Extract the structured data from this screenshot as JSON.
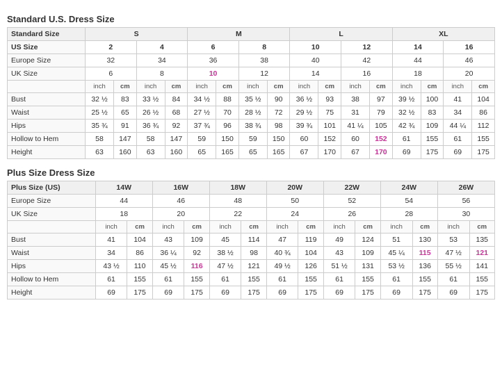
{
  "standard": {
    "title": "Standard U.S. Dress Size",
    "sizes": {
      "standard": [
        "S",
        "M",
        "L",
        "XL"
      ],
      "us": [
        "2",
        "4",
        "6",
        "8",
        "10",
        "12",
        "14",
        "16"
      ],
      "europe": [
        "32",
        "34",
        "36",
        "38",
        "40",
        "42",
        "44",
        "46"
      ],
      "uk": [
        "6",
        "8",
        "10",
        "12",
        "14",
        "16",
        "18",
        "20"
      ]
    },
    "measurements": {
      "bust": {
        "label": "Bust",
        "values": [
          "32 ½",
          "83",
          "33 ½",
          "84",
          "34 ½",
          "88",
          "35 ½",
          "90",
          "36 ½",
          "93",
          "38",
          "97",
          "39 ½",
          "100",
          "41",
          "104"
        ]
      },
      "waist": {
        "label": "Waist",
        "values": [
          "25 ½",
          "65",
          "26 ½",
          "68",
          "27 ½",
          "70",
          "28 ½",
          "72",
          "29 ½",
          "75",
          "31",
          "79",
          "32 ½",
          "83",
          "34",
          "86"
        ]
      },
      "hips": {
        "label": "Hips",
        "values": [
          "35 ¾",
          "91",
          "36 ¾",
          "92",
          "37 ¾",
          "96",
          "38 ¾",
          "98",
          "39 ¾",
          "101",
          "41 ¼",
          "105",
          "42 ¾",
          "109",
          "44 ¼",
          "112"
        ]
      },
      "hollow": {
        "label": "Hollow to Hem",
        "values": [
          "58",
          "147",
          "58",
          "147",
          "59",
          "150",
          "59",
          "150",
          "60",
          "152",
          "60",
          "152",
          "61",
          "155",
          "61",
          "155"
        ]
      },
      "height": {
        "label": "Height",
        "values": [
          "63",
          "160",
          "63",
          "160",
          "65",
          "165",
          "65",
          "165",
          "67",
          "170",
          "67",
          "170",
          "69",
          "175",
          "69",
          "175"
        ]
      }
    }
  },
  "plus": {
    "title": "Plus Size Dress Size",
    "sizes": {
      "plus_us": [
        "14W",
        "16W",
        "18W",
        "20W",
        "22W",
        "24W",
        "26W"
      ],
      "europe": [
        "44",
        "46",
        "48",
        "50",
        "52",
        "54",
        "56"
      ],
      "uk": [
        "18",
        "20",
        "22",
        "24",
        "26",
        "28",
        "30"
      ]
    },
    "measurements": {
      "bust": {
        "label": "Bust",
        "values": [
          "41",
          "104",
          "43",
          "109",
          "45",
          "114",
          "47",
          "119",
          "49",
          "124",
          "51",
          "130",
          "53",
          "135"
        ]
      },
      "waist": {
        "label": "Waist",
        "values": [
          "34",
          "86",
          "36 ¼",
          "92",
          "38 ½",
          "98",
          "40 ¾",
          "104",
          "43",
          "109",
          "45 ¼",
          "115",
          "47 ½",
          "121"
        ]
      },
      "hips": {
        "label": "Hips",
        "values": [
          "43 ½",
          "110",
          "45 ½",
          "116",
          "47 ½",
          "121",
          "49 ½",
          "126",
          "51 ½",
          "131",
          "53 ½",
          "136",
          "55 ½",
          "141"
        ]
      },
      "hollow": {
        "label": "Hollow to Hem",
        "values": [
          "61",
          "155",
          "61",
          "155",
          "61",
          "155",
          "61",
          "155",
          "61",
          "155",
          "61",
          "155",
          "61",
          "155"
        ]
      },
      "height": {
        "label": "Height",
        "values": [
          "69",
          "175",
          "69",
          "175",
          "69",
          "175",
          "69",
          "175",
          "69",
          "175",
          "69",
          "175",
          "69",
          "175"
        ]
      }
    }
  }
}
